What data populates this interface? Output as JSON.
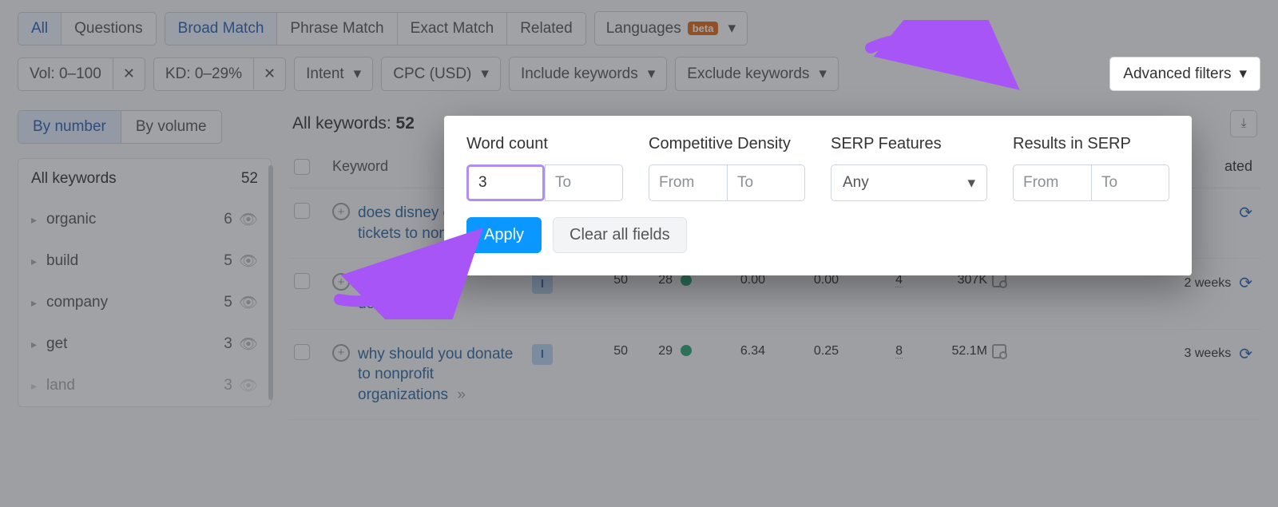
{
  "tabs": {
    "all": "All",
    "questions": "Questions",
    "broad": "Broad Match",
    "phrase": "Phrase Match",
    "exact": "Exact Match",
    "related": "Related"
  },
  "lang": {
    "label": "Languages",
    "beta": "beta"
  },
  "filters": {
    "vol": "Vol: 0–100",
    "kd": "KD: 0–29%",
    "intent": "Intent",
    "cpc": "CPC (USD)",
    "include": "Include keywords",
    "exclude": "Exclude keywords",
    "advanced": "Advanced filters"
  },
  "sidebar": {
    "by_number": "By number",
    "by_volume": "By volume",
    "all": "All keywords",
    "all_count": "52",
    "items": [
      {
        "label": "organic",
        "count": "6"
      },
      {
        "label": "build",
        "count": "5"
      },
      {
        "label": "company",
        "count": "5"
      },
      {
        "label": "get",
        "count": "3"
      },
      {
        "label": "land",
        "count": "3"
      }
    ]
  },
  "main_head": {
    "label": "All keywords: ",
    "count": "52"
  },
  "thead": {
    "keyword": "Keyword",
    "updated": "ated"
  },
  "rows": [
    {
      "kw": "does disney donate tickets to nonprofits"
    },
    {
      "kw": "nonprofit crypto donations",
      "intent": "I",
      "vol": "50",
      "kd": "28",
      "cpc": "0.00",
      "cd": "0.00",
      "serp": "4",
      "results": "307K",
      "updated": "2 weeks"
    },
    {
      "kw": "why should you donate to nonprofit organizations",
      "intent": "I",
      "vol": "50",
      "kd": "29",
      "cpc": "6.34",
      "cd": "0.25",
      "serp": "8",
      "results": "52.1M",
      "updated": "3 weeks"
    }
  ],
  "pop": {
    "wc": "Word count",
    "wc_from": "3",
    "to": "To",
    "from": "From",
    "cd": "Competitive Density",
    "sf": "SERP Features",
    "any": "Any",
    "ris": "Results in SERP",
    "apply": "Apply",
    "clear": "Clear all fields"
  }
}
